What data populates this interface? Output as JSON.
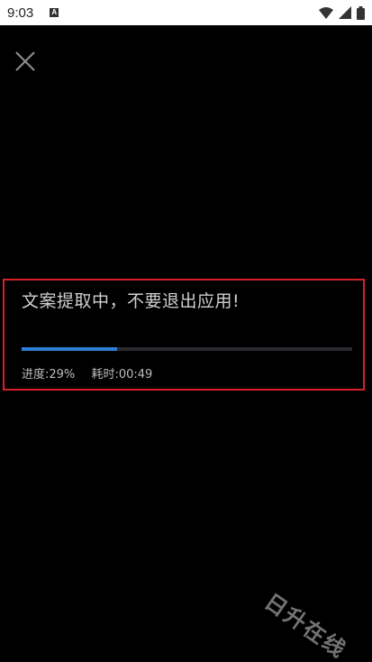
{
  "status_bar": {
    "time": "9:03",
    "notification_icon": "A",
    "icons": [
      "wifi-icon",
      "signal-icon",
      "battery-icon"
    ]
  },
  "close": {
    "icon": "close-icon"
  },
  "progress": {
    "title": "文案提取中，不要退出应用!",
    "percent_label": "进度: ",
    "percent_value": "29%",
    "percent": 29,
    "elapsed_label": "耗时: ",
    "elapsed_value": "00:49"
  },
  "watermark": {
    "text": "日升在线"
  },
  "colors": {
    "background": "#000000",
    "progress_fill": "#2d7fd3",
    "progress_track": "#2a2a30",
    "highlight_border": "#d9202a"
  }
}
